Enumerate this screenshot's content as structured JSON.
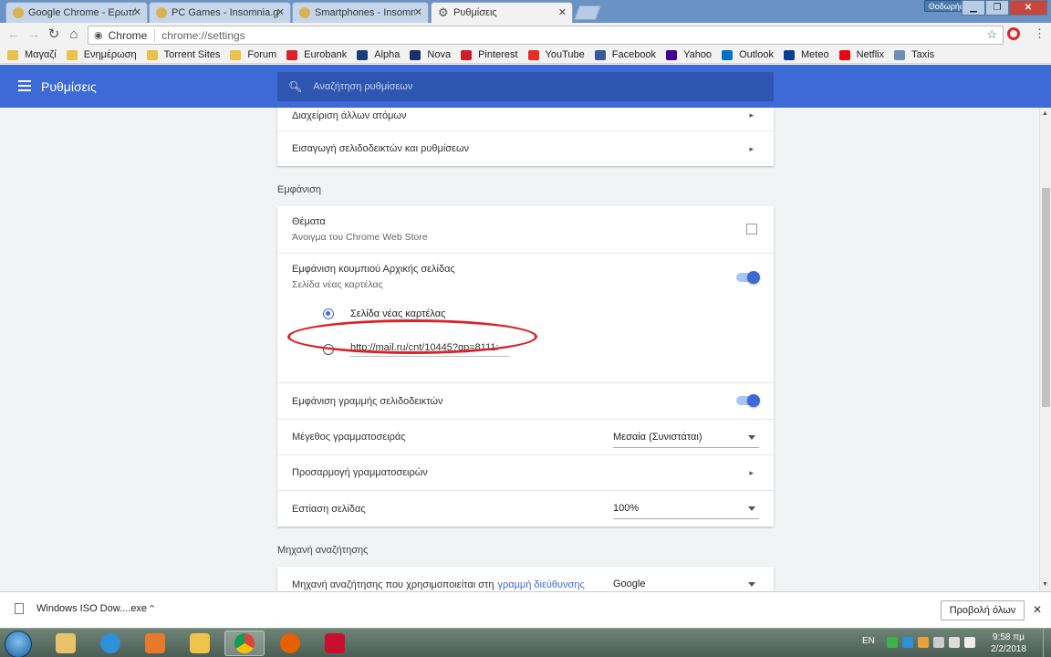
{
  "browser": {
    "tabs": [
      {
        "title": "Google Chrome - Ερωτή"
      },
      {
        "title": "PC Games - Insomnia.gr"
      },
      {
        "title": "Smartphones - Insomnia"
      },
      {
        "title": "Ρυθμίσεις"
      }
    ],
    "profile_name": "Θοδωρής",
    "omnibox": {
      "chip": "Chrome",
      "url": "chrome://settings"
    },
    "bookmarks": [
      {
        "label": "Μαγαζί",
        "color": "#e8c24a"
      },
      {
        "label": "Ενημέρωση",
        "color": "#e8c24a"
      },
      {
        "label": "Torrent Sites",
        "color": "#e8c24a"
      },
      {
        "label": "Forum",
        "color": "#e8c24a"
      },
      {
        "label": "Eurobank",
        "color": "#d8232a"
      },
      {
        "label": "Alpha",
        "color": "#1a3d7c"
      },
      {
        "label": "Nova",
        "color": "#1a2f6a"
      },
      {
        "label": "Pinterest",
        "color": "#cb2027"
      },
      {
        "label": "YouTube",
        "color": "#e52d27"
      },
      {
        "label": "Facebook",
        "color": "#3b5998"
      },
      {
        "label": "Yahoo",
        "color": "#410093"
      },
      {
        "label": "Outlook",
        "color": "#0072c6"
      },
      {
        "label": "Meteo",
        "color": "#0a3d91"
      },
      {
        "label": "Netflix",
        "color": "#e50914"
      },
      {
        "label": "Taxis",
        "color": "#6e8db3"
      }
    ]
  },
  "settings": {
    "title": "Ρυθμίσεις",
    "search_placeholder": "Αναζήτηση ρυθμίσεων",
    "people_rows": [
      "Διαχείριση άλλων ατόμων",
      "Εισαγωγή σελιδοδεικτών και ρυθμίσεων"
    ],
    "appearance": {
      "section_title": "Εμφάνιση",
      "themes_label": "Θέματα",
      "themes_sub": "Άνοιγμα του Chrome Web Store",
      "home_button_label": "Εμφάνιση κουμπιού Αρχικής σελίδας",
      "home_button_sub": "Σελίδα νέας καρτέλας",
      "home_button_on": true,
      "radio_new_tab": "Σελίδα νέας καρτέλας",
      "radio_custom_url": "http://mail.ru/cnt/10445?gp=8111:",
      "bookmarks_bar_label": "Εμφάνιση γραμμής σελιδοδεικτών",
      "bookmarks_bar_on": true,
      "font_size_label": "Μέγεθος γραμματοσειράς",
      "font_size_value": "Μεσαία (Συνιστάται)",
      "customize_fonts_label": "Προσαρμογή γραμματοσειρών",
      "zoom_label": "Εστίαση σελίδας",
      "zoom_value": "100%"
    },
    "search_engine": {
      "section_title": "Μηχανή αναζήτησης",
      "row_label": "Μηχανή αναζήτησης που χρησιμοποιείται στη",
      "row_link": "γραμμή διεύθυνσης",
      "value": "Google"
    }
  },
  "download_bar": {
    "file": "Windows ISO Dow....exe",
    "show_all": "Προβολή όλων"
  },
  "taskbar": {
    "lang": "EN",
    "time": "9:58 πμ",
    "date": "2/2/2018"
  },
  "colors": {
    "accent": "#3d6ad6",
    "annotation": "#d8232a"
  }
}
